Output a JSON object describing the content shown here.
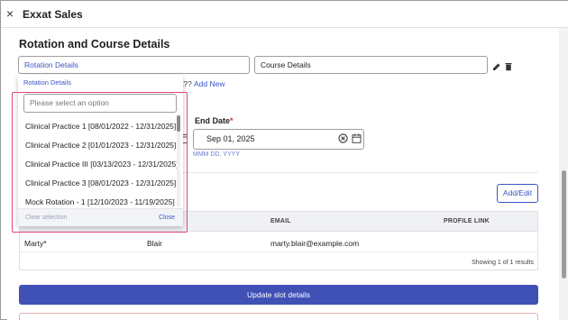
{
  "window": {
    "title": "Exxat Sales",
    "close_glyph": "×"
  },
  "section": {
    "title": "Rotation and Course Details"
  },
  "fields": {
    "rotation_details": "Rotation Details",
    "course_details": "Course Details",
    "question_suffix": "t??",
    "add_new": "Add New"
  },
  "end_date": {
    "label": "End Date",
    "required": "*",
    "value": "Sep 01, 2025",
    "hint": "MMM DD, YYYY"
  },
  "dropdown": {
    "header": "Rotation Details",
    "search_placeholder": "Please select an option",
    "options": [
      "Clinical Practice 1 [08/01/2022 - 12/31/2025]",
      "Clinical Practice 2 [01/01/2023 - 12/31/2025]",
      "Clinical Practice III [03/13/2023 - 12/31/2025]",
      "Clinical Practice 3 [08/01/2023 - 12/31/2025]",
      "Mock Rotation - 1 [12/10/2023 - 11/19/2025]"
    ],
    "clear_label": "Clear selection",
    "close_label": "Close"
  },
  "table": {
    "add_edit": "Add/Edit",
    "headers": {
      "email": "EMAIL",
      "profile_link": "PROFILE LINK"
    },
    "rows": [
      {
        "first": "Marty*",
        "last": "Blair",
        "email": "marty.blair@example.com"
      }
    ],
    "showing": "Showing 1 of 1 results"
  },
  "update_button": "Update slot details",
  "colors": {
    "accent": "#3f51b5",
    "link": "#3a55c4",
    "highlight": "#e0487c"
  }
}
